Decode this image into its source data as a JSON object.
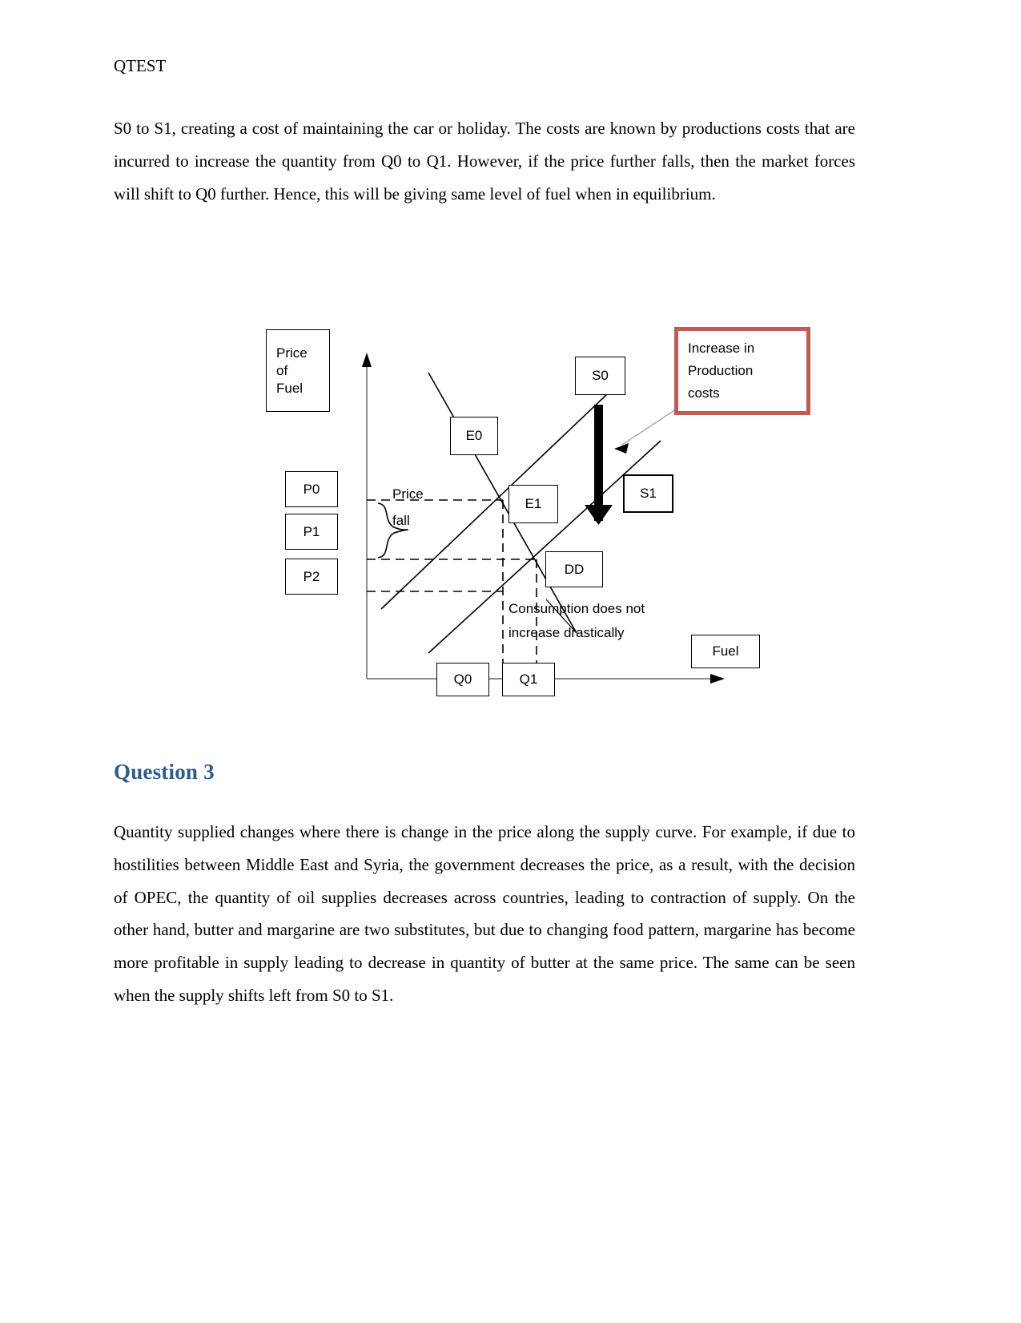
{
  "document": {
    "header": "QTEST",
    "paragraph_1": "S0 to S1, creating a cost of maintaining the car or holiday. The costs are known by productions costs that are incurred to increase the quantity from Q0 to Q1. However, if the price further falls, then the market forces will shift to Q0 further. Hence, this will be giving same level of fuel when in equilibrium.",
    "question_heading": "Question 3",
    "paragraph_2": "Quantity supplied changes where there is change in the price along the supply curve. For example, if due to hostilities between Middle East and Syria, the government decreases the price, as a result, with the decision of OPEC, the quantity of oil supplies decreases across countries, leading to contraction of supply. On the other hand, butter and margarine are two substitutes, but due to changing food pattern, margarine has become more profitable in supply leading to decrease in quantity of butter at the same price. The same can be seen when the supply shifts left from S0 to S1."
  },
  "colors": {
    "heading_blue": "#2e5c8a",
    "callout_red": "#bf5b53",
    "axis_gray": "#808080",
    "curve_black": "#000000"
  },
  "figure": {
    "y_axis_label": "Price\nof\nFuel",
    "x_axis_label": "Fuel",
    "price_labels": [
      "P0",
      "P1",
      "P2"
    ],
    "quantity_labels": [
      "Q0",
      "Q1"
    ],
    "equilibrium_labels": [
      "E0",
      "E1"
    ],
    "supply_labels": [
      "S0",
      "S1"
    ],
    "demand_label": "DD",
    "brace_note": "Price\nfall",
    "callout_note": "Increase in\nProduction\ncosts",
    "consumption_note": "Consumption does not\nincrease drastically"
  },
  "chart_data": {
    "type": "line",
    "title": "Fuel market: supply shift from S0 to S1",
    "xlabel": "Fuel",
    "ylabel": "Price of Fuel",
    "grid": false,
    "legend": "inline-labels",
    "axis_ranges": {
      "x": [
        0,
        10
      ],
      "y": [
        0,
        10
      ]
    },
    "series": [
      {
        "name": "S0",
        "role": "supply-original",
        "points": [
          [
            1.2,
            1.0
          ],
          [
            7.0,
            8.0
          ]
        ]
      },
      {
        "name": "S1",
        "role": "supply-shifted",
        "points": [
          [
            2.9,
            0.6
          ],
          [
            8.6,
            7.2
          ]
        ]
      },
      {
        "name": "DD",
        "role": "demand",
        "points": [
          [
            3.5,
            9.3
          ],
          [
            7.6,
            1.2
          ]
        ]
      }
    ],
    "annotated_points": [
      {
        "name": "E0",
        "x_label": "Q0",
        "y_label": "P0",
        "x": 5.2,
        "y": 5.2
      },
      {
        "name": "E1",
        "x_label": "Q1",
        "y_label": "P1",
        "x": 5.9,
        "y": 3.6
      }
    ],
    "price_levels": [
      {
        "label": "P0",
        "value": 5.2
      },
      {
        "label": "P1",
        "value": 3.6
      },
      {
        "label": "P2",
        "value": 2.4
      }
    ],
    "quantity_levels": [
      {
        "label": "Q0",
        "value": 5.2
      },
      {
        "label": "Q1",
        "value": 5.9
      }
    ],
    "annotations": [
      "Price fall",
      "Increase in Production costs",
      "Consumption does not increase drastically"
    ]
  }
}
